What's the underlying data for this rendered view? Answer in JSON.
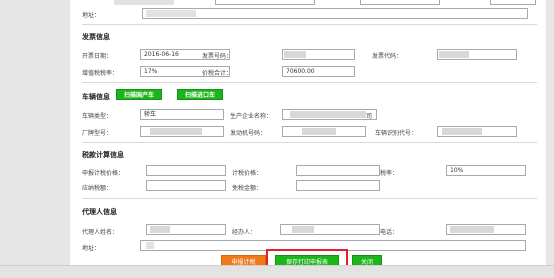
{
  "top": {
    "address_label": "地址："
  },
  "invoice": {
    "title": "发票信息",
    "date_label": "开票日期：",
    "date_value": "2016-06-16",
    "invoice_no_label": "发票号码：",
    "invoice_code_label": "发票代码：",
    "vat_rate_label": "增值税税率：",
    "vat_rate_value": "17%",
    "total_label": "价税合计：",
    "total_value": "70600.00"
  },
  "vehicle": {
    "title": "车辆信息",
    "scan_domestic": "扫描国产车",
    "scan_import": "扫描进口车",
    "type_label": "车辆类型：",
    "type_value": "轿车",
    "manufacturer_label": "生产企业名称：",
    "manufacturer_suffix": "司",
    "model_label": "厂牌型号：",
    "engine_label": "发动机号码：",
    "vin_label": "车辆识别代号："
  },
  "tax": {
    "title": "税款计算信息",
    "declared_price_label": "申报计税价格：",
    "tax_price_label": "计税价格：",
    "tax_rate_label": "税率：",
    "tax_rate_value": "10%",
    "payable_label": "应纳税额：",
    "exemption_label": "免税金额："
  },
  "agent": {
    "title": "代理人信息",
    "name_label": "代理人姓名：",
    "handler_label": "经办人：",
    "phone_label": "电话：",
    "address_label": "地址："
  },
  "actions": {
    "calc": "申报计税",
    "save_print": "保存打印申报表",
    "close": "关闭"
  }
}
